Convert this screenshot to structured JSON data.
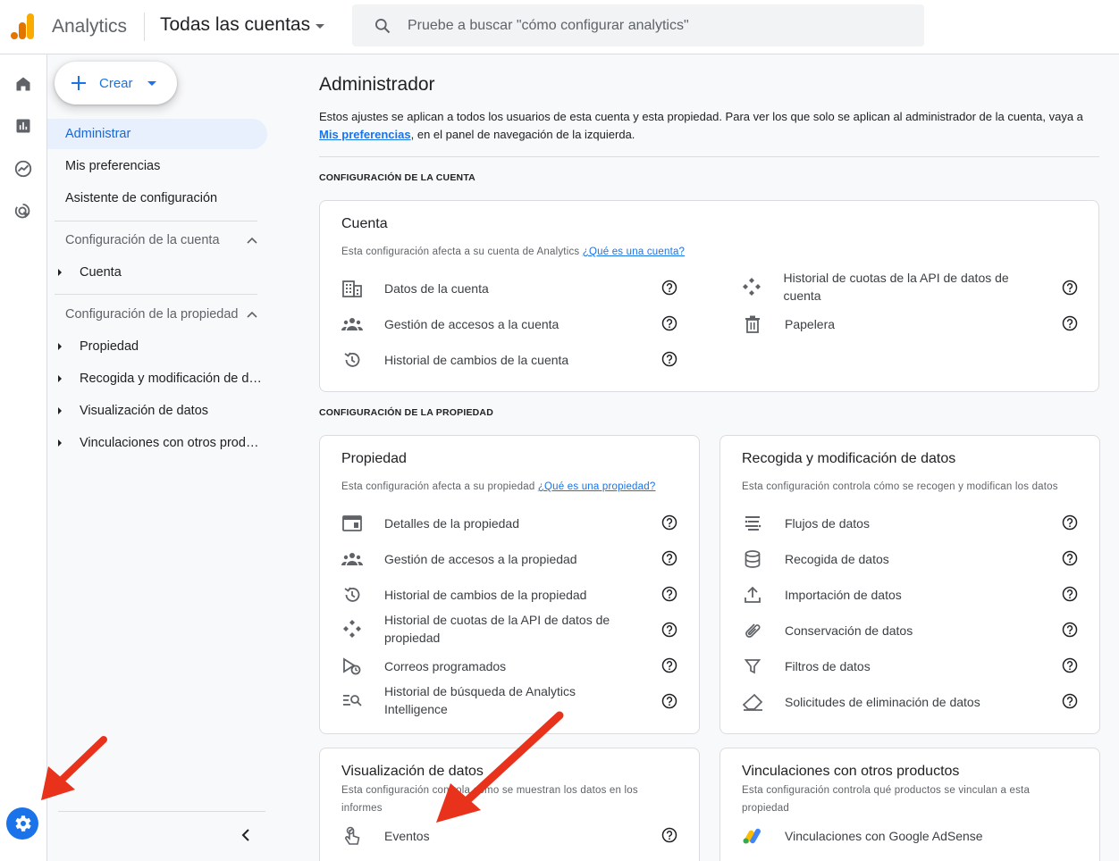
{
  "header": {
    "app_name": "Analytics",
    "account_selector": "Todas las cuentas",
    "search_placeholder": "Pruebe a buscar \"cómo configurar analytics\""
  },
  "rail": {
    "icons": [
      "home-icon",
      "reports-icon",
      "explore-icon",
      "advertising-icon"
    ],
    "settings_icon": "gear-icon"
  },
  "sidebar": {
    "create_label": "Crear",
    "items": [
      {
        "label": "Administrar",
        "active": true
      },
      {
        "label": "Mis preferencias",
        "active": false
      },
      {
        "label": "Asistente de configuración",
        "active": false
      }
    ],
    "account_section": {
      "title": "Configuración de la cuenta",
      "items": [
        "Cuenta"
      ]
    },
    "property_section": {
      "title": "Configuración de la propiedad",
      "items": [
        "Propiedad",
        "Recogida y modificación de datos",
        "Visualización de datos",
        "Vinculaciones con otros productos"
      ]
    }
  },
  "main": {
    "title": "Administrador",
    "intro_before": "Estos ajustes se aplican a todos los usuarios de esta cuenta y esta propiedad. Para ver los que solo se aplican al administrador de la cuenta, vaya a ",
    "intro_link": "Mis preferencias",
    "intro_after": ", en el panel de navegación de la izquierda.",
    "account_header": "CONFIGURACIÓN DE LA CUENTA",
    "property_header": "CONFIGURACIÓN DE LA PROPIEDAD",
    "account_card": {
      "title": "Cuenta",
      "desc": "Esta configuración afecta a su cuenta de Analytics ",
      "desc_link": "¿Qué es una cuenta?",
      "left": [
        "Datos de la cuenta",
        "Gestión de accesos a la cuenta",
        "Historial de cambios de la cuenta"
      ],
      "right": [
        "Historial de cuotas de la API de datos de cuenta",
        "Papelera"
      ]
    },
    "property_card": {
      "title": "Propiedad",
      "desc": "Esta configuración afecta a su propiedad ",
      "desc_link": "¿Qué es una propiedad?",
      "items": [
        "Detalles de la propiedad",
        "Gestión de accesos a la propiedad",
        "Historial de cambios de la propiedad",
        "Historial de cuotas de la API de datos de propiedad",
        "Correos programados",
        "Historial de búsqueda de Analytics Intelligence"
      ]
    },
    "data_card": {
      "title": "Recogida y modificación de datos",
      "desc": "Esta configuración controla cómo se recogen y modifican los datos",
      "items": [
        "Flujos de datos",
        "Recogida de datos",
        "Importación de datos",
        "Conservación de datos",
        "Filtros de datos",
        "Solicitudes de eliminación de datos"
      ]
    },
    "display_card": {
      "title": "Visualización de datos",
      "desc": "Esta configuración controla cómo se muestran los datos en los informes",
      "items": [
        "Eventos"
      ]
    },
    "links_card": {
      "title": "Vinculaciones con otros productos",
      "desc": "Esta configuración controla qué productos se vinculan a esta propiedad",
      "items": [
        "Vinculaciones con Google AdSense"
      ]
    }
  },
  "colors": {
    "accent": "#1a73e8",
    "annotation_arrow": "#e8321c"
  }
}
